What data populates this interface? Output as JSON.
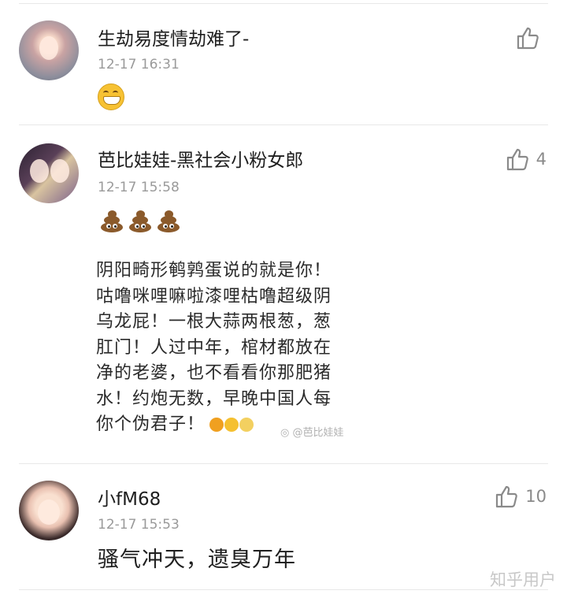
{
  "comments": [
    {
      "name": "生劫易度情劫难了-",
      "time": "12-17 16:31",
      "like_count": "",
      "emoji": "grinning-face"
    },
    {
      "name": "芭比娃娃-黑社会小粉女郎",
      "time": "12-17 15:58",
      "like_count": "4",
      "emoji": "pile-of-poo x3",
      "quote_lines": [
        "阴阳畸形鹌鹑蛋说的就是你！",
        "咕噜咪哩嘛啦漆哩枯噜超级阴",
        "乌龙屁！一根大蒜两根葱，葱",
        "肛门！人过中年，棺材都放在",
        "净的老婆，也不看看你那肥猪",
        "水！约炮无数，早晚中国人每",
        "你个伪君子！"
      ],
      "quote_watermark": "@芭比娃娃"
    },
    {
      "name": "小fM68",
      "time": "12-17 15:53",
      "like_count": "10",
      "text": "骚气冲天，遗臭万年"
    }
  ],
  "watermark": "知乎用户",
  "colors": {
    "text": "#1e1e1e",
    "meta": "#9a9a9a",
    "divider": "#e8e8e8",
    "icon": "#8a8a8a"
  }
}
